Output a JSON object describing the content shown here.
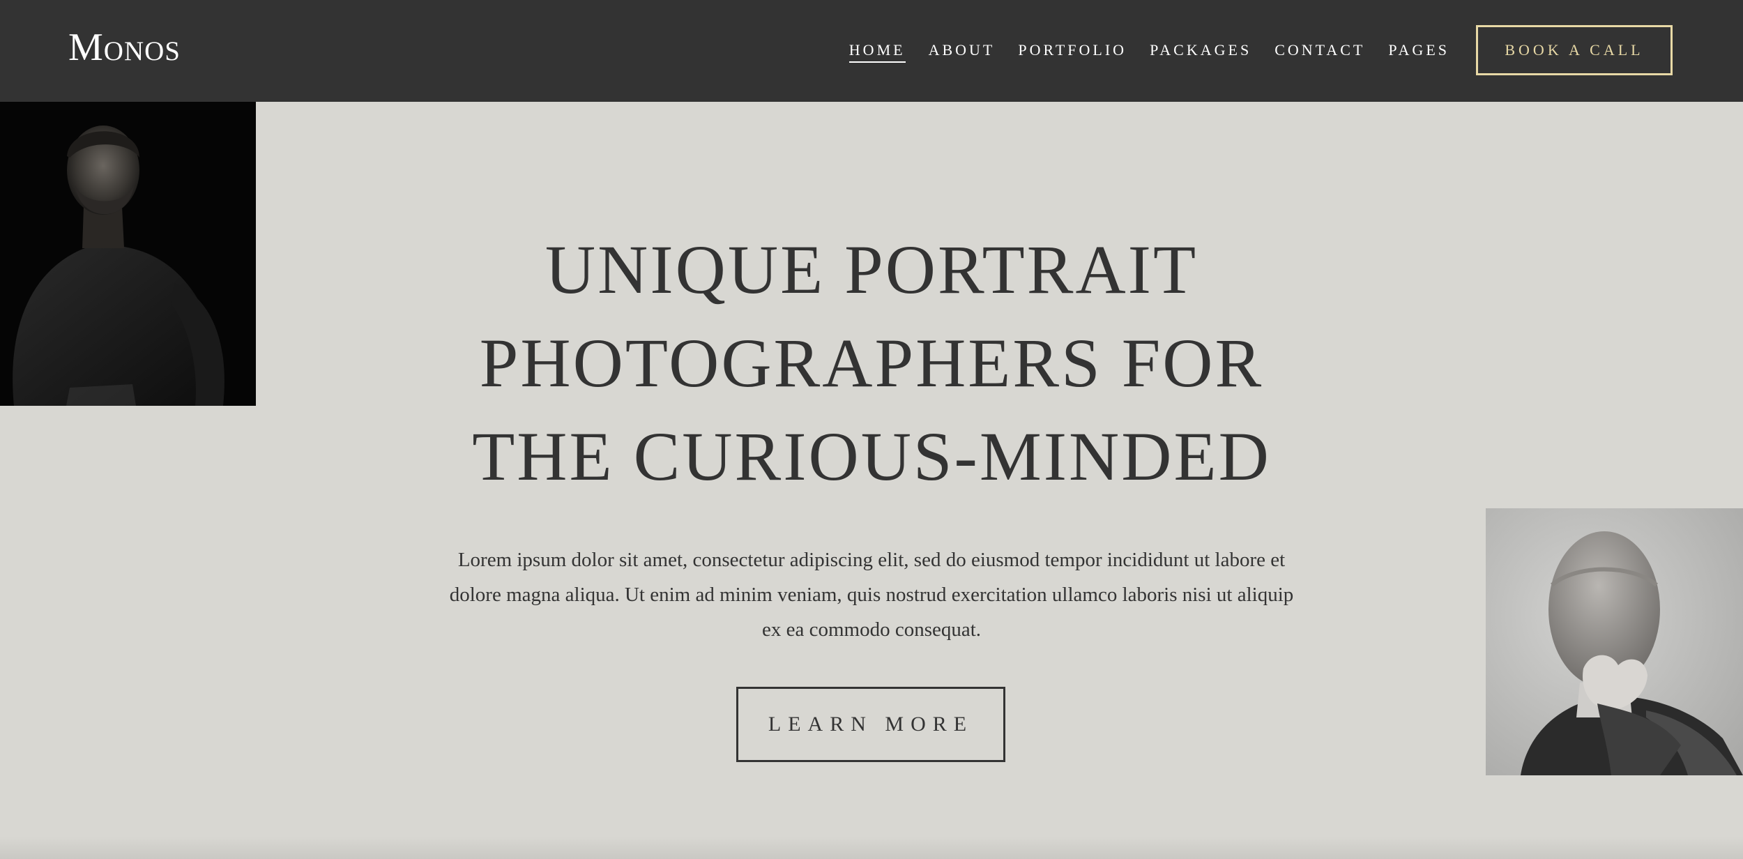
{
  "header": {
    "logo": "Monos",
    "nav": [
      {
        "label": "HOME",
        "active": true
      },
      {
        "label": "ABOUT"
      },
      {
        "label": "PORTFOLIO"
      },
      {
        "label": "PACKAGES"
      },
      {
        "label": "CONTACT"
      },
      {
        "label": "PAGES"
      }
    ],
    "cta_label": "BOOK A CALL"
  },
  "hero": {
    "headline_lines": [
      "UNIQUE PORTRAIT",
      "PHOTOGRAPHERS FOR",
      "THE CURIOUS-MINDED"
    ],
    "body": "Lorem ipsum dolor sit amet, consectetur adipiscing elit, sed do eiusmod tempor incididunt ut labore et dolore magna aliqua. Ut enim ad minim veniam, quis nostrud exercitation ullamco laboris nisi ut aliquip ex ea commodo consequat.",
    "button_label": "LEARN MORE"
  },
  "colors": {
    "page_bg": "#d8d7d2",
    "header_bg": "#333333",
    "accent": "#e8d9a6",
    "text": "#333333"
  }
}
